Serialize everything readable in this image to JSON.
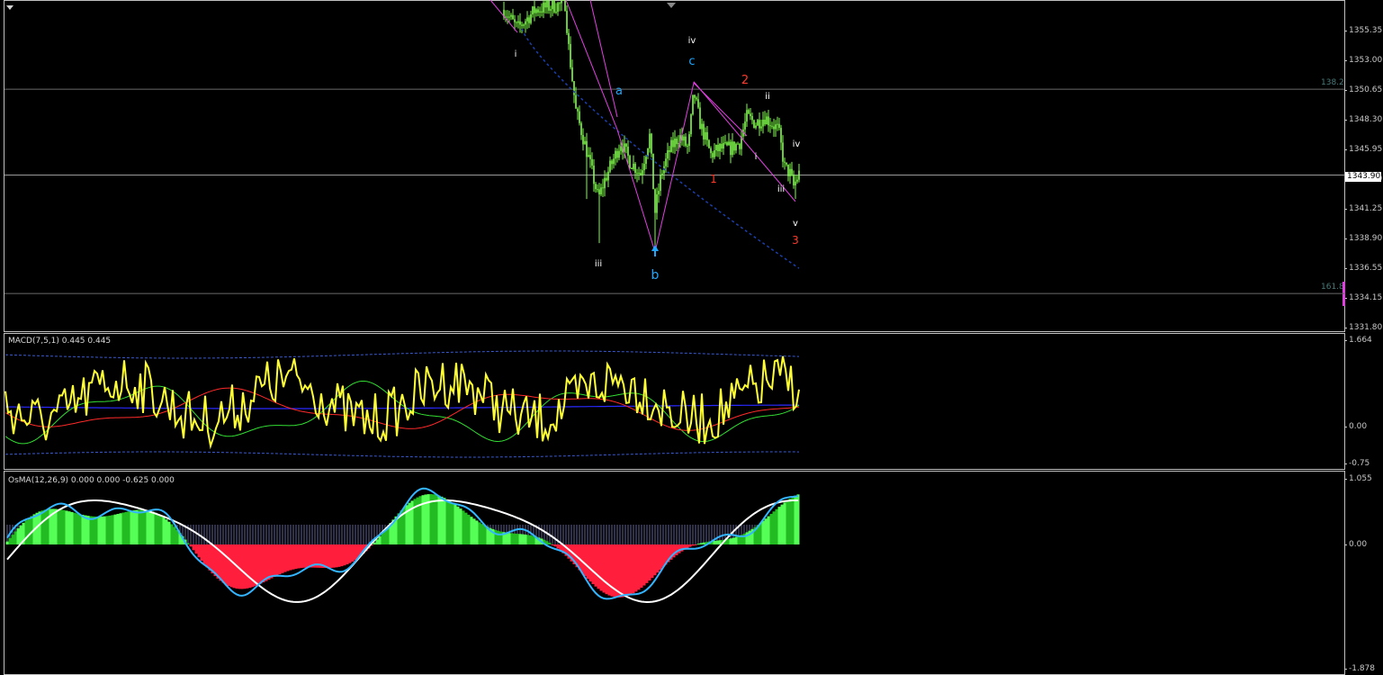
{
  "chart_data": [
    {
      "type": "candlestick",
      "price_ticks": [
        "1355.35",
        "1353.00",
        "1350.65",
        "1348.30",
        "1345.95",
        "1343.60",
        "1341.25",
        "1338.90",
        "1336.55",
        "1334.15",
        "1331.80"
      ],
      "current_price": "1343.90",
      "fib_levels": [
        {
          "label": "138.2",
          "price": 1350.7
        },
        {
          "label": "161.8",
          "price": 1334.5
        }
      ],
      "horizontal_line_price": 1343.9,
      "wave_labels": [
        {
          "text": "i",
          "color": "#ffffff"
        },
        {
          "text": "iii",
          "color": "#ffffff"
        },
        {
          "text": "a",
          "color": "#1ea7ff"
        },
        {
          "text": "b",
          "color": "#1ea7ff"
        },
        {
          "text": "iv",
          "color": "#ffffff"
        },
        {
          "text": "c",
          "color": "#1ea7ff"
        },
        {
          "text": "1",
          "color": "#ff3a2a"
        },
        {
          "text": "2",
          "color": "#ff3a2a"
        },
        {
          "text": "ii",
          "color": "#ffffff"
        },
        {
          "text": "i",
          "color": "#ffffff"
        },
        {
          "text": "iv",
          "color": "#ffffff"
        },
        {
          "text": "iii",
          "color": "#ffffff"
        },
        {
          "text": "v",
          "color": "#ffffff"
        },
        {
          "text": "3",
          "color": "#ff3a2a"
        }
      ],
      "colors": {
        "candles": "#7fff4a",
        "wave_lines": "#e040e0",
        "trend": "#1c3ea8"
      }
    },
    {
      "type": "line",
      "label": "MACD(7,5,1) 0.445 0.445",
      "ticks": [
        "1.664",
        "0.00",
        "-0.75"
      ],
      "colors": {
        "main": "#ffff33",
        "signal": "#ff2a2a",
        "green": "#33dd33",
        "blue": "#2a2aff",
        "bands": "#3a5ad0"
      }
    },
    {
      "type": "bar",
      "label": "OsMA(12,26,9) 0.000 0.000 -0.625 0.000",
      "ticks": [
        "1.055",
        "0.00",
        "-1.878"
      ],
      "colors": {
        "positive": "#22bb22",
        "positive_light": "#55ff55",
        "negative": "#ff1e3c",
        "line_white": "#ffffff",
        "line_blue": "#33b5ff"
      }
    }
  ]
}
